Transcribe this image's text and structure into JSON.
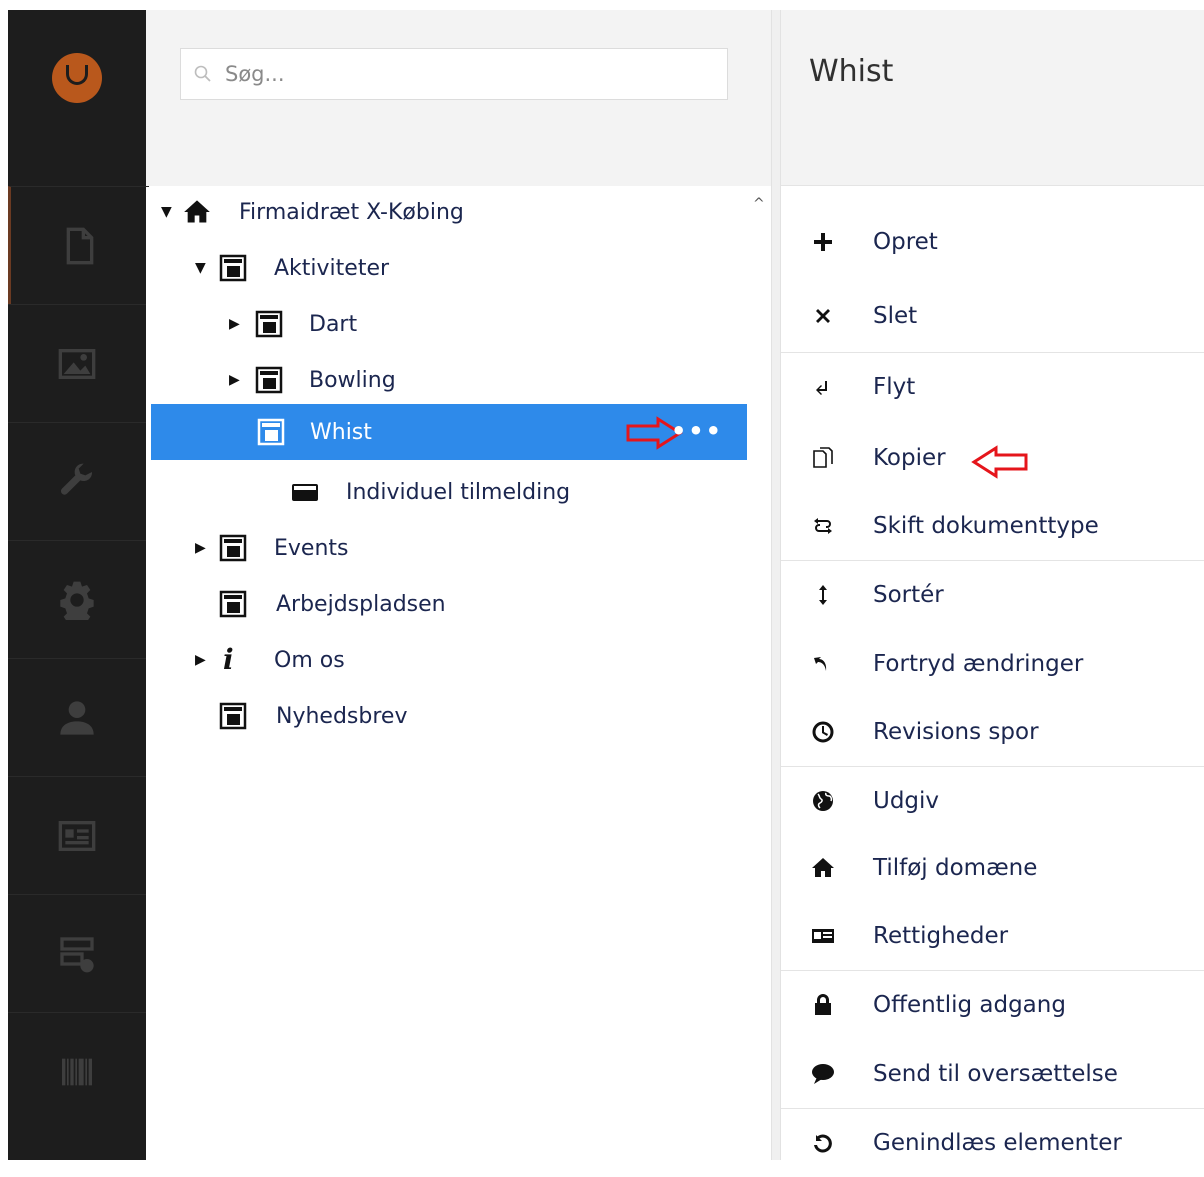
{
  "search": {
    "placeholder": "Søg..."
  },
  "rail": {
    "items": [
      {
        "icon": "document-icon"
      },
      {
        "icon": "image-icon"
      },
      {
        "icon": "wrench-icon"
      },
      {
        "icon": "gear-icon"
      },
      {
        "icon": "user-icon"
      },
      {
        "icon": "id-card-icon"
      },
      {
        "icon": "form-add-icon"
      },
      {
        "icon": "barcode-icon"
      }
    ],
    "accent": "#b9581c"
  },
  "tree": {
    "nodes": [
      {
        "label": "Firmaidræt X-Købing",
        "icon": "home-icon",
        "expanded": true
      },
      {
        "label": "Aktiviteter",
        "icon": "page-icon",
        "expanded": true
      },
      {
        "label": "Dart",
        "icon": "page-icon",
        "expanded": false
      },
      {
        "label": "Bowling",
        "icon": "page-icon",
        "expanded": false
      },
      {
        "label": "Whist",
        "icon": "page-icon",
        "selected": true
      },
      {
        "label": "Individuel tilmelding",
        "icon": "card-icon"
      },
      {
        "label": "Events",
        "icon": "page-icon",
        "expanded": false
      },
      {
        "label": "Arbejdspladsen",
        "icon": "page-icon"
      },
      {
        "label": "Om os",
        "icon": "info-icon",
        "expanded": false
      },
      {
        "label": "Nyhedsbrev",
        "icon": "page-icon"
      }
    ],
    "selected_color": "#2e8aea",
    "more_label": "•••"
  },
  "actions": {
    "title": "Whist",
    "items": [
      {
        "label": "Opret",
        "icon": "plus-icon"
      },
      {
        "label": "Slet",
        "icon": "x-icon"
      },
      {
        "label": "Flyt",
        "icon": "move-icon"
      },
      {
        "label": "Kopier",
        "icon": "copy-icon"
      },
      {
        "label": "Skift dokumenttype",
        "icon": "swap-icon"
      },
      {
        "label": "Sortér",
        "icon": "sort-icon"
      },
      {
        "label": "Fortryd ændringer",
        "icon": "undo-icon"
      },
      {
        "label": "Revisions spor",
        "icon": "clock-icon"
      },
      {
        "label": "Udgiv",
        "icon": "globe-icon"
      },
      {
        "label": "Tilføj domæne",
        "icon": "home-icon"
      },
      {
        "label": "Rettigheder",
        "icon": "id-card-icon"
      },
      {
        "label": "Offentlig adgang",
        "icon": "lock-icon"
      },
      {
        "label": "Send til oversættelse",
        "icon": "speech-bubble-icon"
      },
      {
        "label": "Genindlæs elementer",
        "icon": "reload-icon"
      }
    ]
  },
  "annotation_color": "#e5151b"
}
